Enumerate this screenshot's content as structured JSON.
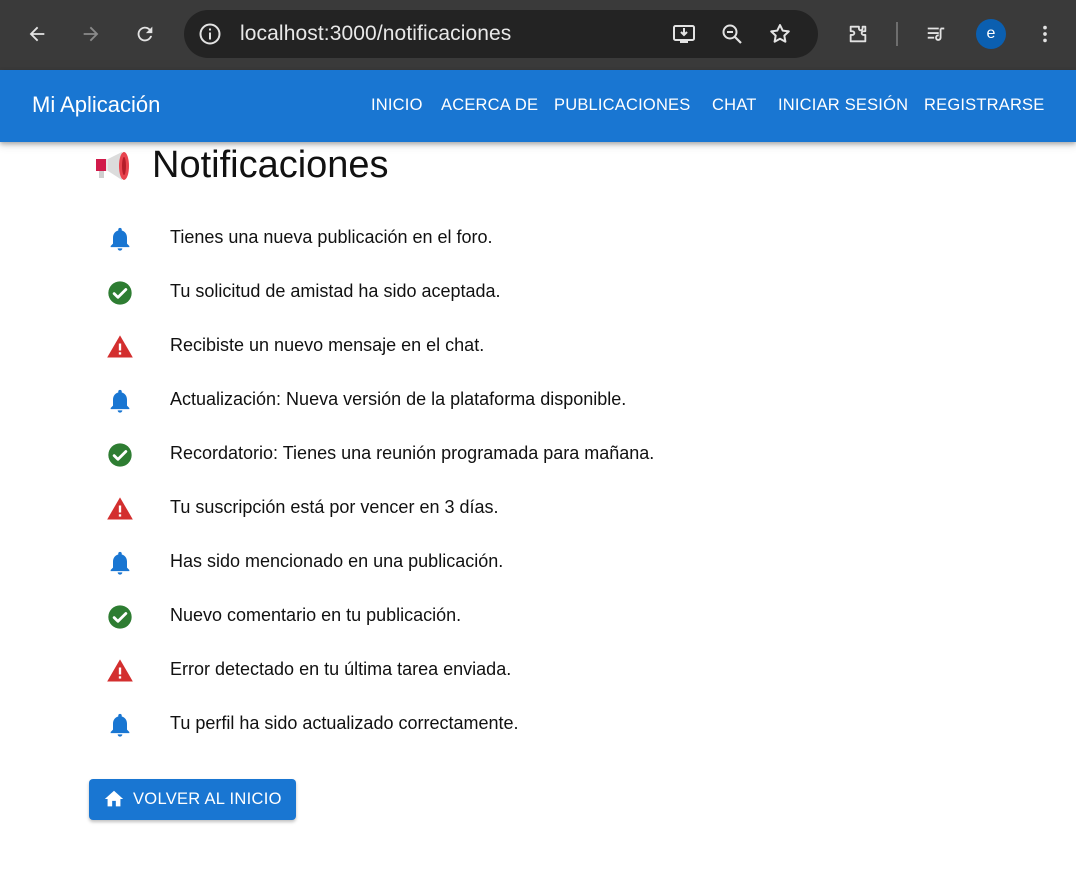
{
  "browser": {
    "url": "localhost:3000/notificaciones",
    "profile_initial": "e"
  },
  "appbar": {
    "brand": "Mi Aplicación",
    "nav": [
      "INICIO",
      "ACERCA DE",
      "PUBLICACIONES",
      "CHAT",
      "INICIAR SESIÓN",
      "REGISTRARSE"
    ],
    "color": "#1976d2"
  },
  "page": {
    "title_icon": "megaphone-icon",
    "title": "Notificaciones"
  },
  "notifications": [
    {
      "type": "info",
      "icon": "bell-icon",
      "text": "Tienes una nueva publicación en el foro."
    },
    {
      "type": "success",
      "icon": "check-circle-icon",
      "text": "Tu solicitud de amistad ha sido aceptada."
    },
    {
      "type": "warning",
      "icon": "warning-triangle-icon",
      "text": "Recibiste un nuevo mensaje en el chat."
    },
    {
      "type": "info",
      "icon": "bell-icon",
      "text": "Actualización: Nueva versión de la plataforma disponible."
    },
    {
      "type": "success",
      "icon": "check-circle-icon",
      "text": "Recordatorio: Tienes una reunión programada para mañana."
    },
    {
      "type": "warning",
      "icon": "warning-triangle-icon",
      "text": "Tu suscripción está por vencer en 3 días."
    },
    {
      "type": "info",
      "icon": "bell-icon",
      "text": "Has sido mencionado en una publicación."
    },
    {
      "type": "success",
      "icon": "check-circle-icon",
      "text": "Nuevo comentario en tu publicación."
    },
    {
      "type": "warning",
      "icon": "warning-triangle-icon",
      "text": "Error detectado en tu última tarea enviada."
    },
    {
      "type": "info",
      "icon": "bell-icon",
      "text": "Tu perfil ha sido actualizado correctamente."
    }
  ],
  "status_colors": {
    "info": "#1976d2",
    "success": "#2e7d32",
    "warning": "#d32f2f"
  },
  "back_button": {
    "icon": "home-icon",
    "label": "VOLVER AL INICIO"
  }
}
